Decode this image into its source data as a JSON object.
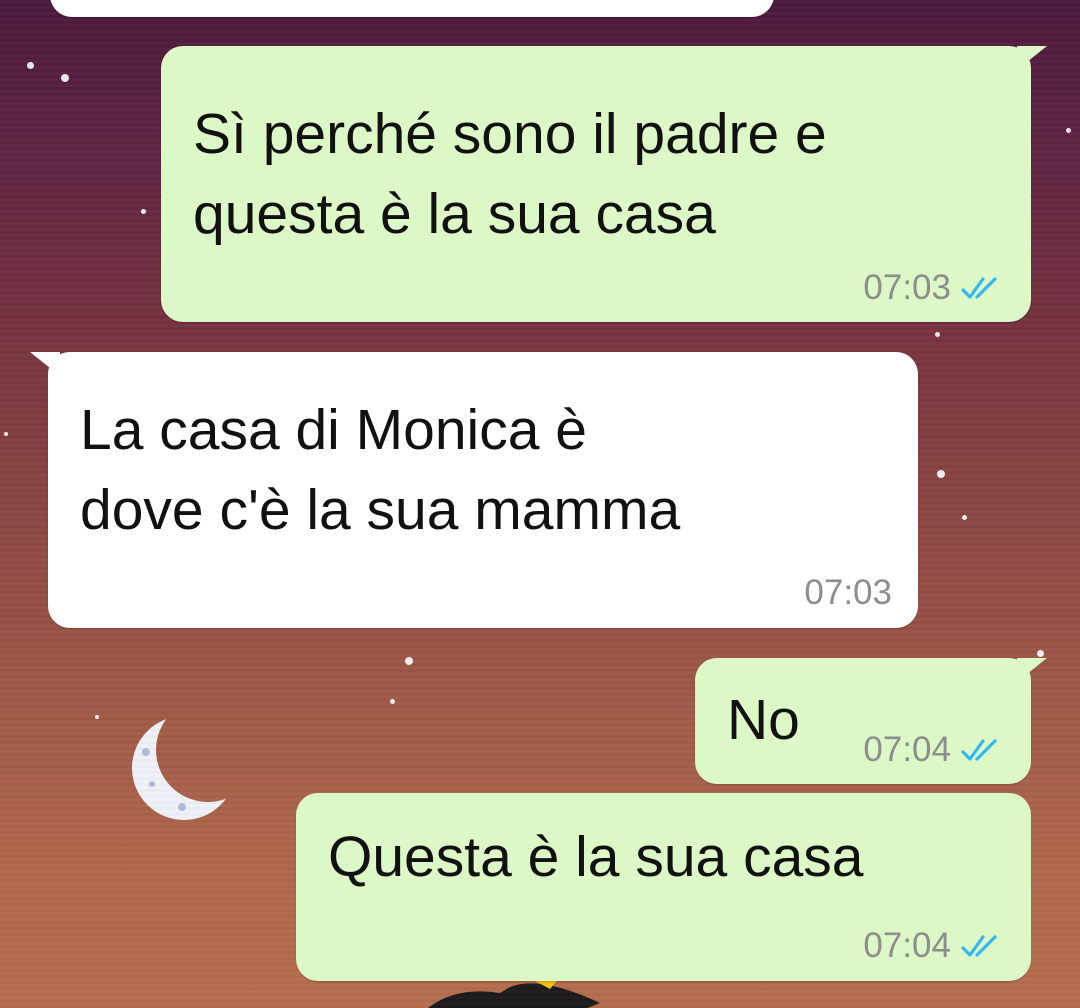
{
  "colors": {
    "outgoing_bubble": "#dcf8c6",
    "incoming_bubble": "#ffffff",
    "read_ticks": "#34b7f1",
    "timestamp": "#8d8d8d"
  },
  "messages": [
    {
      "direction": "outgoing",
      "text": "Sì perché sono il padre e\nquesta è la sua casa",
      "time": "07:03",
      "status_icon": "double-check-read-icon"
    },
    {
      "direction": "incoming",
      "text": "La casa di Monica è\ndove c'è la sua mamma",
      "time": "07:03"
    },
    {
      "direction": "outgoing",
      "text": "No",
      "time": "07:04",
      "status_icon": "double-check-read-icon"
    },
    {
      "direction": "outgoing",
      "text": "Questa è la sua casa",
      "time": "07:04",
      "status_icon": "double-check-read-icon"
    }
  ]
}
